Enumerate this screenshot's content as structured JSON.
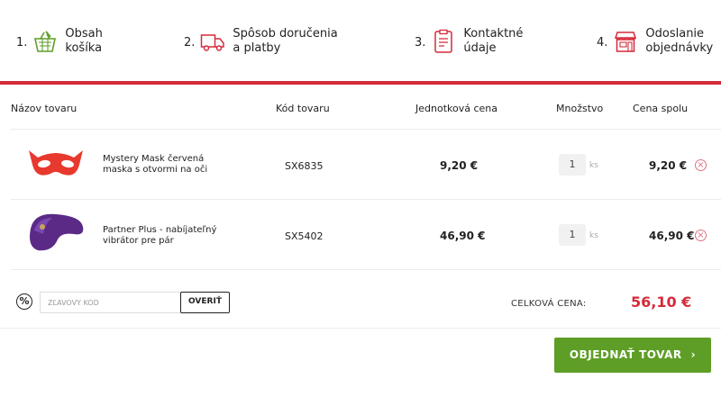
{
  "steps": [
    {
      "num": "1.",
      "line1": "Obsah",
      "line2": "košíka",
      "icon": "basket-icon"
    },
    {
      "num": "2.",
      "line1": "Spôsob doručenia",
      "line2": "a platby",
      "icon": "truck-icon"
    },
    {
      "num": "3.",
      "line1": "Kontaktné",
      "line2": "údaje",
      "icon": "clipboard-icon"
    },
    {
      "num": "4.",
      "line1": "Odoslanie",
      "line2": "objednávky",
      "icon": "shop-icon"
    }
  ],
  "table": {
    "headers": {
      "name": "Názov tovaru",
      "code": "Kód tovaru",
      "unit_price": "Jednotková cena",
      "quantity": "Množstvo",
      "total": "Cena spolu"
    },
    "rows": [
      {
        "name_line1": "Mystery Mask červená",
        "name_line2": "maska s otvormi na oči",
        "code": "SX6835",
        "unit_price": "9,20 €",
        "qty": "1",
        "unit": "ks",
        "total": "9,20 €"
      },
      {
        "name_line1": "Partner Plus - nabíjateľný",
        "name_line2": "vibrátor pre pár",
        "code": "SX5402",
        "unit_price": "46,90 €",
        "qty": "1",
        "unit": "ks",
        "total": "46,90 €"
      }
    ]
  },
  "coupon": {
    "placeholder": "ZĽAVOVÝ KÓD",
    "verify_label": "OVERIŤ"
  },
  "summary": {
    "total_label": "CELKOVÁ CENA:",
    "total_value": "56,10 €"
  },
  "order_button": {
    "label": "OBJEDNAŤ TOVAR",
    "chevron": "›"
  },
  "colors": {
    "accent_red": "#d52a3a",
    "button_green": "#5e9e26"
  }
}
